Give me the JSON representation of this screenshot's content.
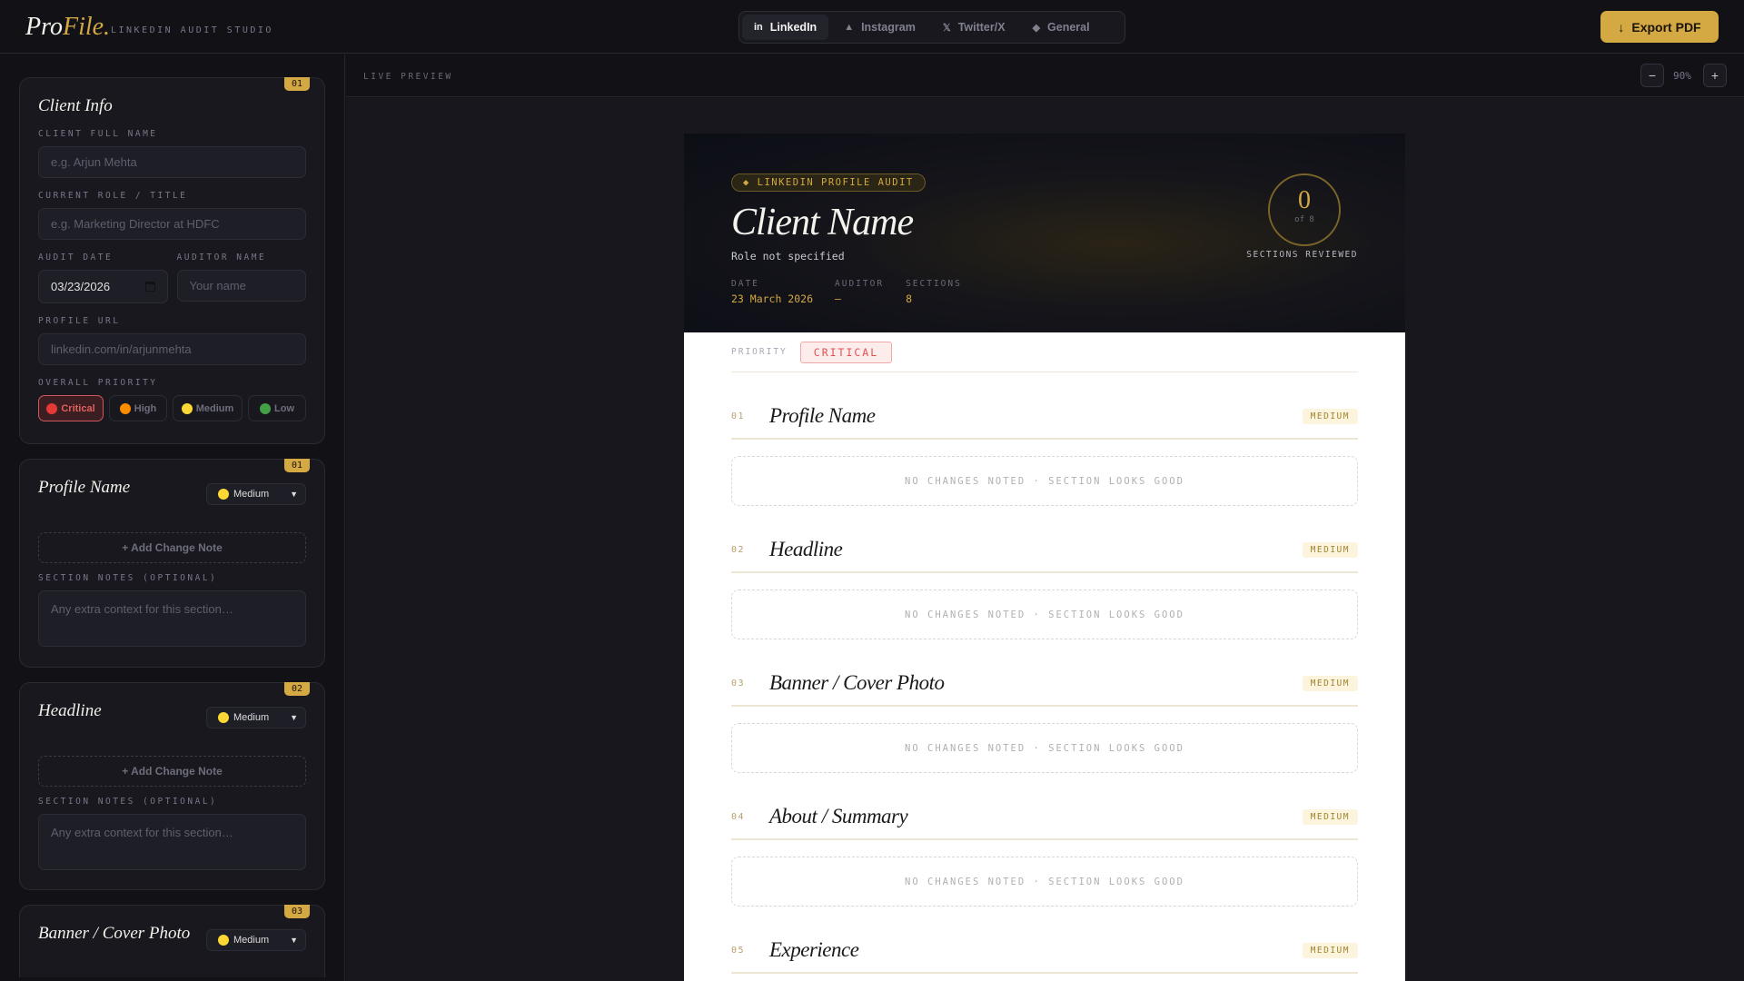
{
  "app": {
    "logo_pro": "Pro",
    "logo_file": "File.",
    "subtitle": "LINKEDIN AUDIT STUDIO"
  },
  "tabs": [
    {
      "label": "LinkedIn",
      "icon": "in"
    },
    {
      "label": "Instagram",
      "icon": "▲"
    },
    {
      "label": "Twitter/X",
      "icon": "𝕏"
    },
    {
      "label": "General",
      "icon": "◆"
    }
  ],
  "export": {
    "label": "Export PDF",
    "icon": "↓"
  },
  "client": {
    "badge": "01",
    "title": "Client Info",
    "name_label": "CLIENT FULL NAME",
    "name_ph": "e.g. Arjun Mehta",
    "role_label": "CURRENT ROLE / TITLE",
    "role_ph": "e.g. Marketing Director at HDFC",
    "date_label": "AUDIT DATE",
    "date_value": "03/23/2026",
    "auditor_label": "AUDITOR NAME",
    "auditor_ph": "Your name",
    "url_label": "PROFILE URL",
    "url_ph": "linkedin.com/in/arjunmehta",
    "priority_label": "OVERALL PRIORITY",
    "priorities": [
      {
        "label": "Critical",
        "color": "#e53935"
      },
      {
        "label": "High",
        "color": "#fb8c00"
      },
      {
        "label": "Medium",
        "color": "#fdd835"
      },
      {
        "label": "Low",
        "color": "#43a047"
      }
    ]
  },
  "editor_sections": [
    {
      "badge": "01",
      "title": "Profile Name",
      "priority": "Medium",
      "add": "+ Add Change Note",
      "notes_label": "SECTION NOTES (OPTIONAL)",
      "notes_ph": "Any extra context for this section…"
    },
    {
      "badge": "02",
      "title": "Headline",
      "priority": "Medium",
      "add": "+ Add Change Note",
      "notes_label": "SECTION NOTES (OPTIONAL)",
      "notes_ph": "Any extra context for this section…"
    },
    {
      "badge": "03",
      "title": "Banner / Cover Photo",
      "priority": "Medium"
    }
  ],
  "preview": {
    "label": "LIVE PREVIEW",
    "zoom": "90%",
    "minus": "−",
    "plus": "+",
    "kicker": "◆ LINKEDIN PROFILE AUDIT",
    "client_name": "Client Name",
    "role": "Role not specified",
    "meta": [
      {
        "k": "DATE",
        "v": "23 March 2026"
      },
      {
        "k": "AUDITOR",
        "v": "—"
      },
      {
        "k": "SECTIONS",
        "v": "8"
      }
    ],
    "reviewed": "0",
    "of": "of 8",
    "reviewed_label": "SECTIONS REVIEWED",
    "priority_key": "PRIORITY",
    "priority_value": "CRITICAL",
    "empty": "NO CHANGES NOTED · SECTION LOOKS GOOD",
    "sections": [
      {
        "num": "01",
        "title": "Profile Name",
        "badge": "MEDIUM"
      },
      {
        "num": "02",
        "title": "Headline",
        "badge": "MEDIUM"
      },
      {
        "num": "03",
        "title": "Banner / Cover Photo",
        "badge": "MEDIUM"
      },
      {
        "num": "04",
        "title": "About / Summary",
        "badge": "MEDIUM"
      },
      {
        "num": "05",
        "title": "Experience",
        "badge": "MEDIUM"
      }
    ]
  }
}
